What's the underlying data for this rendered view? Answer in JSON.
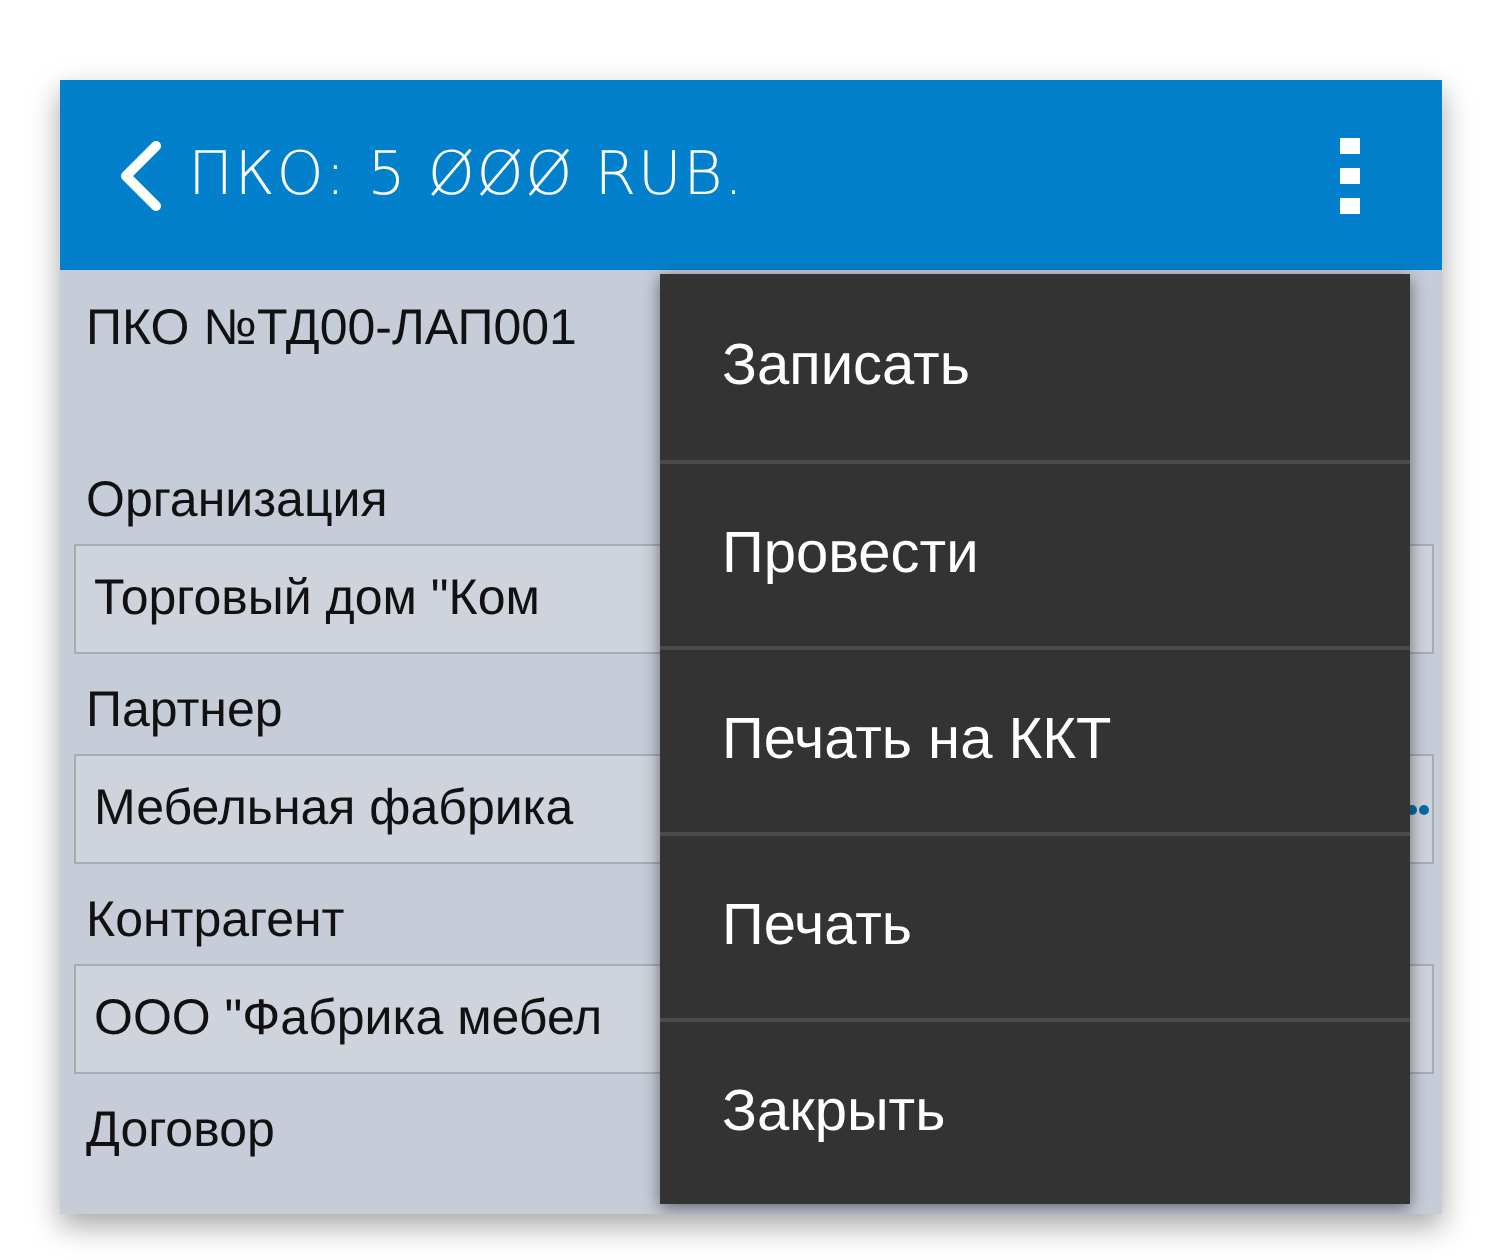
{
  "header": {
    "title": "ПКО: 5 ØØØ RUB."
  },
  "document": {
    "title": "ПКО №ТД00-ЛАП001"
  },
  "fields": [
    {
      "label": "Организация",
      "value": "Торговый дом \"Ком",
      "has_dots": false
    },
    {
      "label": "Партнер",
      "value": "Мебельная фабрика",
      "has_dots": true
    },
    {
      "label": "Контрагент",
      "value": "ООО \"Фабрика мебел",
      "has_dots": false
    }
  ],
  "last_label": "Договор",
  "menu": [
    "Записать",
    "Провести",
    "Печать на ККТ",
    "Печать",
    "Закрыть"
  ]
}
